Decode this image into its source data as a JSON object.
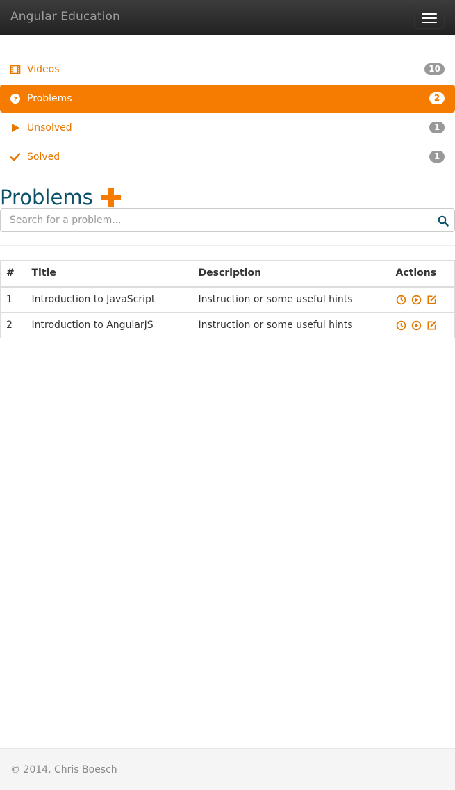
{
  "navbar": {
    "brand": "Angular Education",
    "toggle_icon": "hamburger-menu-icon"
  },
  "menu": {
    "accent_color": "#f57c00",
    "items": [
      {
        "label": "Videos",
        "count": "10",
        "icon": "film-icon",
        "active": false
      },
      {
        "label": "Problems",
        "count": "2",
        "icon": "question-circle-icon",
        "active": true
      },
      {
        "label": "Unsolved",
        "count": "1",
        "icon": "play-icon",
        "active": false
      },
      {
        "label": "Solved",
        "count": "1",
        "icon": "checkmark-icon",
        "active": false
      }
    ]
  },
  "main": {
    "title": "Problems",
    "add_icon": "plus-icon",
    "search": {
      "placeholder": "Search for a problem...",
      "value": "",
      "icon": "search-icon"
    },
    "table": {
      "headers": [
        "#",
        "Title",
        "Description",
        "Actions"
      ],
      "rows": [
        {
          "num": "1",
          "title": "Introduction to JavaScript",
          "description": "Instruction or some useful hints",
          "actions": [
            "clock-icon",
            "play-circle-icon",
            "edit-icon"
          ]
        },
        {
          "num": "2",
          "title": "Introduction to AngularJS",
          "description": "Instruction or some useful hints",
          "actions": [
            "clock-icon",
            "play-circle-icon",
            "edit-icon"
          ]
        }
      ]
    }
  },
  "footer": {
    "text": "© 2014, Chris Boesch"
  },
  "colors": {
    "accent": "#f57c00",
    "heading": "#0c4f68",
    "navbar": "#222222"
  }
}
